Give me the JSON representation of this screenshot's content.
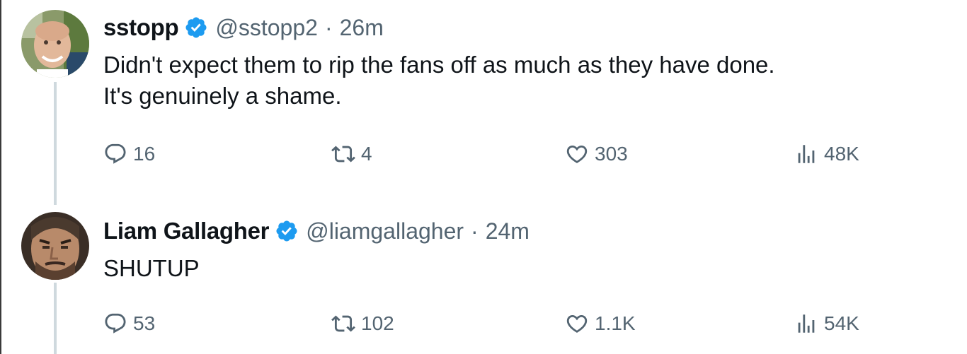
{
  "colors": {
    "verified_blue": "#1d9bf0",
    "secondary_text": "#536471",
    "primary_text": "#0f1419",
    "thread_line": "#cfd9de"
  },
  "tweets": [
    {
      "display_name": "sstopp",
      "handle": "@sstopp2",
      "separator": "·",
      "time": "26m",
      "verified": true,
      "lines": [
        "Didn't expect them to rip the fans off as much as they have done.",
        "It's genuinely a shame."
      ],
      "actions": {
        "replies": "16",
        "reposts": "4",
        "likes": "303",
        "views": "48K"
      },
      "icons": {
        "reply": "reply-icon",
        "repost": "repost-icon",
        "like": "heart-icon",
        "views": "views-icon"
      }
    },
    {
      "display_name": "Liam Gallagher",
      "handle": "@liamgallagher",
      "separator": "·",
      "time": "24m",
      "verified": true,
      "lines": [
        "SHUTUP"
      ],
      "actions": {
        "replies": "53",
        "reposts": "102",
        "likes": "1.1K",
        "views": "54K"
      },
      "icons": {
        "reply": "reply-icon",
        "repost": "repost-icon",
        "like": "heart-icon",
        "views": "views-icon"
      }
    }
  ]
}
